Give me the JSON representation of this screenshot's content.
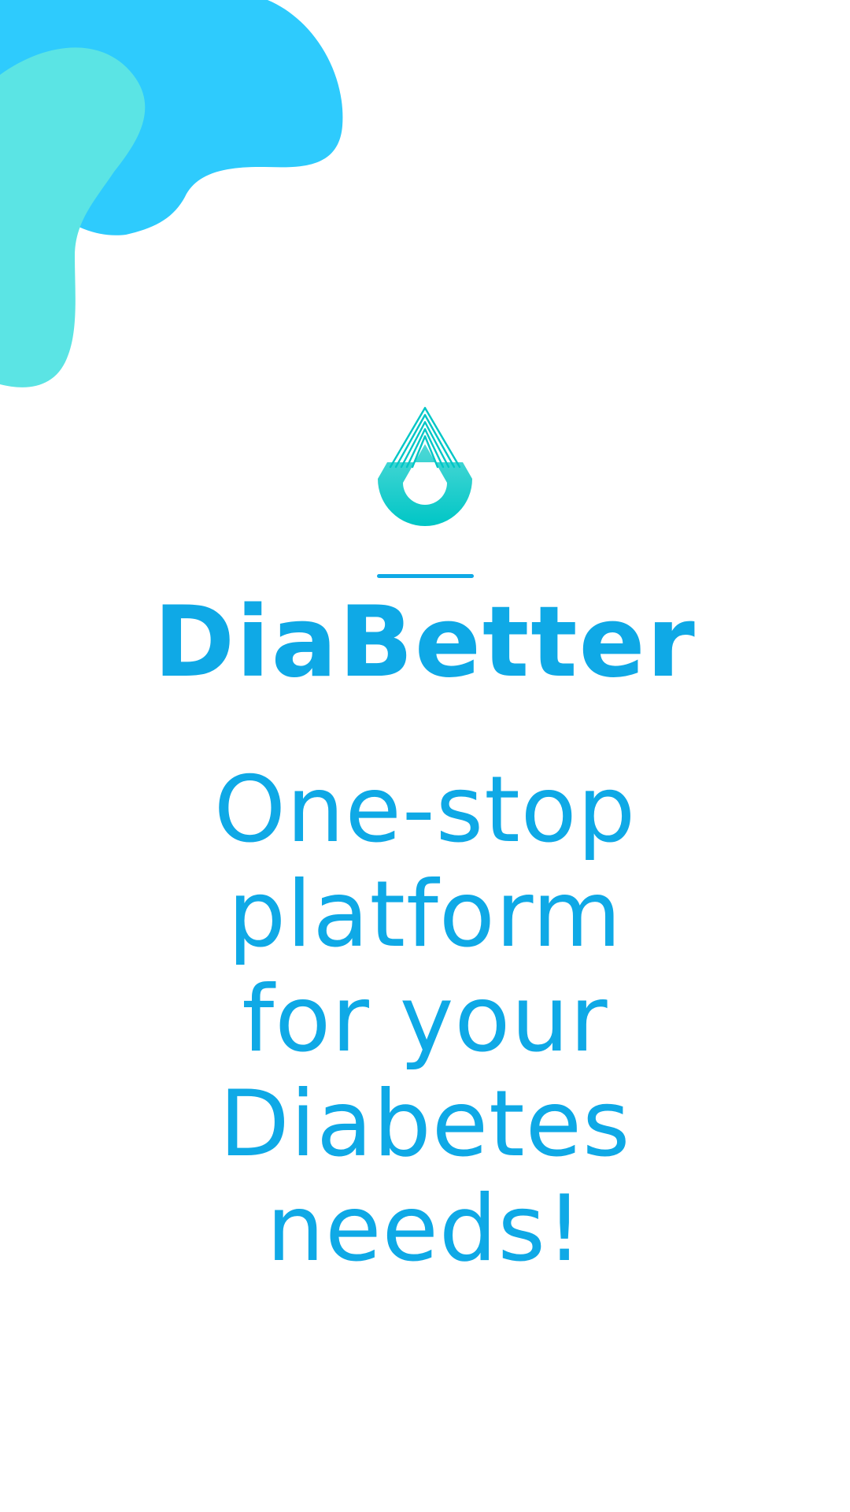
{
  "brand": {
    "name": "DiaBetter"
  },
  "tagline": {
    "lines": [
      "One-stop",
      "platform",
      "for your",
      "Diabetes",
      "needs!"
    ]
  },
  "icons": {
    "logo": "water-drop-logo-icon"
  },
  "colors": {
    "primary": "#0fa9e6",
    "blob_blue": "#2ecbfd",
    "blob_teal": "#5be4e4",
    "logo_teal": "#00cccb",
    "background": "#ffffff"
  }
}
